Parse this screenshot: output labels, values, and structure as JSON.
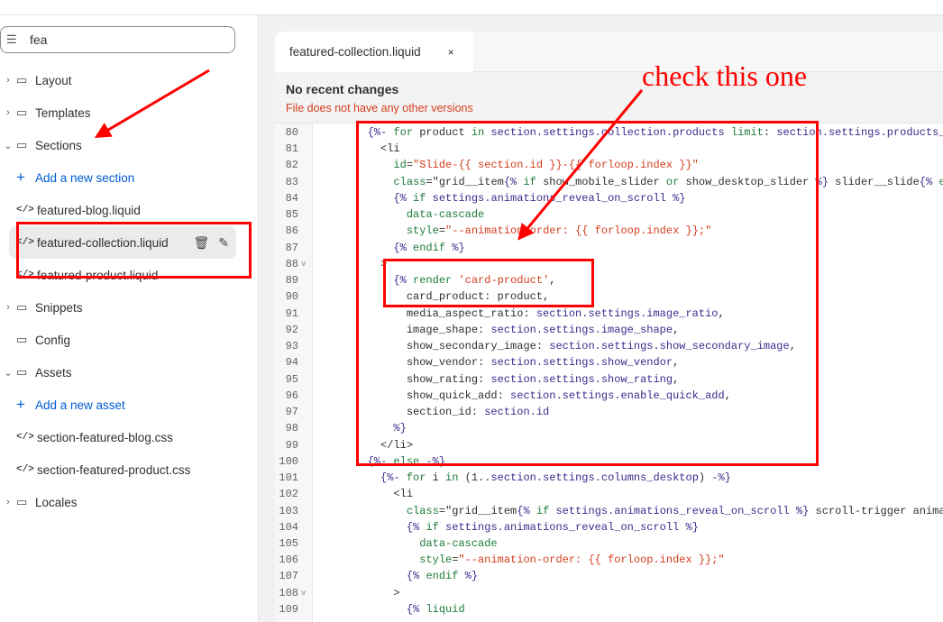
{
  "sidebar": {
    "search_value": "fea",
    "items": [
      {
        "type": "folder",
        "label": "Layout"
      },
      {
        "type": "folder",
        "label": "Templates"
      },
      {
        "type": "folder-open",
        "label": "Sections"
      },
      {
        "type": "add",
        "label": "Add a new section"
      },
      {
        "type": "file",
        "label": "featured-blog.liquid"
      },
      {
        "type": "file",
        "label": "featured-collection.liquid",
        "selected": true
      },
      {
        "type": "file",
        "label": "featured-product.liquid"
      },
      {
        "type": "folder",
        "label": "Snippets"
      },
      {
        "type": "folder-nochev",
        "label": "Config"
      },
      {
        "type": "folder-open",
        "label": "Assets"
      },
      {
        "type": "add",
        "label": "Add a new asset"
      },
      {
        "type": "file",
        "label": "section-featured-blog.css"
      },
      {
        "type": "file",
        "label": "section-featured-product.css"
      },
      {
        "type": "folder",
        "label": "Locales"
      }
    ]
  },
  "editor": {
    "tab_label": "featured-collection.liquid",
    "tab_close": "×",
    "history_title": "No recent changes",
    "history_subtitle": "File does not have any other versions",
    "first_line": 80,
    "fold_lines": [
      88,
      108
    ],
    "lines": [
      "        {%- for product in section.settings.collection.products limit: section.settings.products_to_show -%}",
      "          <li",
      "            id=\"Slide-{{ section.id }}-{{ forloop.index }}\"",
      "            class=\"grid__item{% if show_mobile_slider or show_desktop_slider %} slider__slide{% endif %}",
      "            {% if settings.animations_reveal_on_scroll %}",
      "              data-cascade",
      "              style=\"--animation-order: {{ forloop.index }};\"",
      "            {% endif %}",
      "          >",
      "            {% render 'card-product',",
      "              card_product: product,",
      "              media_aspect_ratio: section.settings.image_ratio,",
      "              image_shape: section.settings.image_shape,",
      "              show_secondary_image: section.settings.show_secondary_image,",
      "              show_vendor: section.settings.show_vendor,",
      "              show_rating: section.settings.show_rating,",
      "              show_quick_add: section.settings.enable_quick_add,",
      "              section_id: section.id",
      "            %}",
      "          </li>",
      "        {%- else -%}",
      "          {%- for i in (1..section.settings.columns_desktop) -%}",
      "            <li",
      "              class=\"grid__item{% if settings.animations_reveal_on_scroll %} scroll-trigger animate--slide-in",
      "              {% if settings.animations_reveal_on_scroll %}",
      "                data-cascade",
      "                style=\"--animation-order: {{ forloop.index }};\"",
      "              {% endif %}",
      "            >",
      "              {% liquid"
    ]
  },
  "annotation": {
    "note": "check this one",
    "color": "#ff0000"
  }
}
